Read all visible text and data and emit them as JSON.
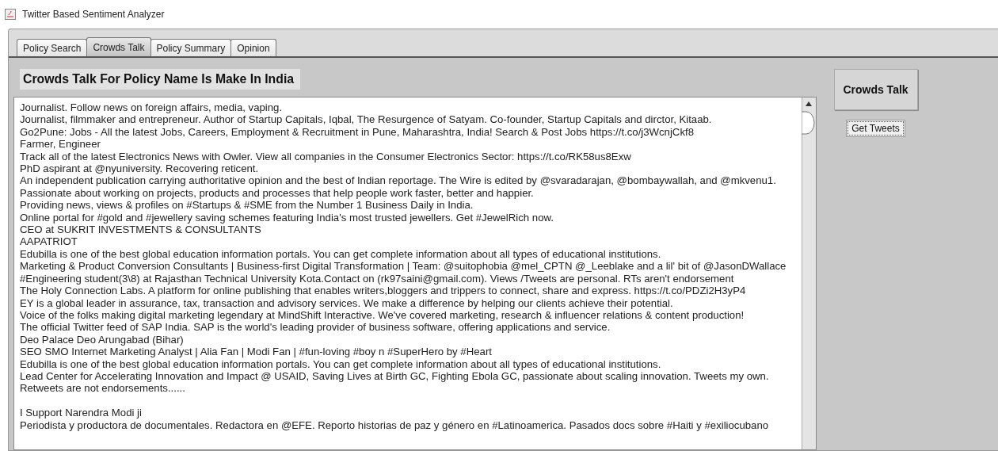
{
  "window": {
    "title": "Twitter Based Sentiment Analyzer"
  },
  "tabs": [
    {
      "label": "Policy Search",
      "selected": false
    },
    {
      "label": "Crowds Talk",
      "selected": true
    },
    {
      "label": "Policy Summary",
      "selected": false
    },
    {
      "label": "Opinion",
      "selected": false
    }
  ],
  "heading": "Crowds Talk For Policy Name Is Make In India",
  "bios": [
    {
      "text": "Journalist. Follow news on foreign affairs, media, vaping."
    },
    {
      "text": "Journalist, filmmaker and entrepreneur. Author of Startup Capitals, Iqbal, The Resurgence of Satyam. Co-founder, Startup Capitals and dirctor, Kitaab."
    },
    {
      "text": "Go2Pune: Jobs - All the latest Jobs, Careers, Employment & Recruitment in Pune, Maharashtra, India! Search & Post Jobs https://t.co/j3WcnjCkf8"
    },
    {
      "text": "Farmer, Engineer"
    },
    {
      "text": "Track all of the latest Electronics News with Owler. View all companies in the Consumer Electronics Sector: https://t.co/RK58us8Exw"
    },
    {
      "text": "PhD aspirant at @nyuniversity. Recovering reticent."
    },
    {
      "text": "An independent publication carrying authoritative opinion and the best of Indian reportage. The Wire is edited by @svaradarajan, @bombaywallah, and @mkvenu1."
    },
    {
      "text": "Passionate about working on projects, products and processes that help people work faster, better and happier."
    },
    {
      "text": "Providing news, views & profiles on #Startups & #SME from the Number 1 Business Daily in India."
    },
    {
      "text": "Online portal for #gold and #jewellery saving schemes featuring India's most trusted jewellers. Get #JewelRich now."
    },
    {
      "text": "CEO at SUKRIT INVESTMENTS & CONSULTANTS"
    },
    {
      "text": "AAPATRIOT"
    },
    {
      "text": "Edubilla is one of the best global education information portals. You can get complete information about all types of educational institutions."
    },
    {
      "text": "Marketing & Product Conversion Consultants | Business-first Digital Transformation | Team: @suitophobia @mel_CPTN @_Leeblake and a lil' bit of @JasonDWallace"
    },
    {
      "text": "#Engineering student(3\\8) at Rajasthan Technical University Kota.Contact on (rk97saini@gmail.com).  Views /Tweets are personal. RTs aren't endorsement"
    },
    {
      "text": "The Holy Connection Labs. A platform for online publishing that enables writers,bloggers and trippers to connect, share and express. https://t.co/PDZi2H3yP4"
    },
    {
      "text": "EY is a global leader in assurance, tax, transaction and advisory services. We make a difference by helping our clients achieve their potential."
    },
    {
      "text": "Voice of the folks making digital marketing legendary at MindShift Interactive. We've covered marketing, research & influencer relations & content production!"
    },
    {
      "text": "The official Twitter feed of SAP India. SAP is the world's leading provider of business software, offering applications and service."
    },
    {
      "text": "Deo Palace Deo Arungabad (Bihar)"
    },
    {
      "text": "SEO SMO Internet Marketing Analyst | Alia Fan | Modi Fan | #fun-loving #boy n #SuperHero by #Heart"
    },
    {
      "text": "Edubilla is one of the best global education information portals. You can get complete information about all types of educational institutions."
    },
    {
      "text": "Lead Center for Accelerating Innovation and Impact @ USAID, Saving Lives at Birth GC, Fighting Ebola GC, passionate about scaling innovation.  Tweets my own."
    },
    {
      "text": "Retweets are not endorsements......"
    },
    {
      "text": "I Support Narendra Modi ji",
      "blank_before": true
    },
    {
      "text": "Periodista y productora de documentales. Redactora en @EFE. Reporto historias de paz y género en #Latinoamerica. Pasados docs sobre #Haiti y #exiliocubano"
    }
  ],
  "buttons": [
    {
      "label": "Crowds Talk",
      "kind": "large"
    },
    {
      "label": "Get Tweets",
      "kind": "small"
    }
  ]
}
